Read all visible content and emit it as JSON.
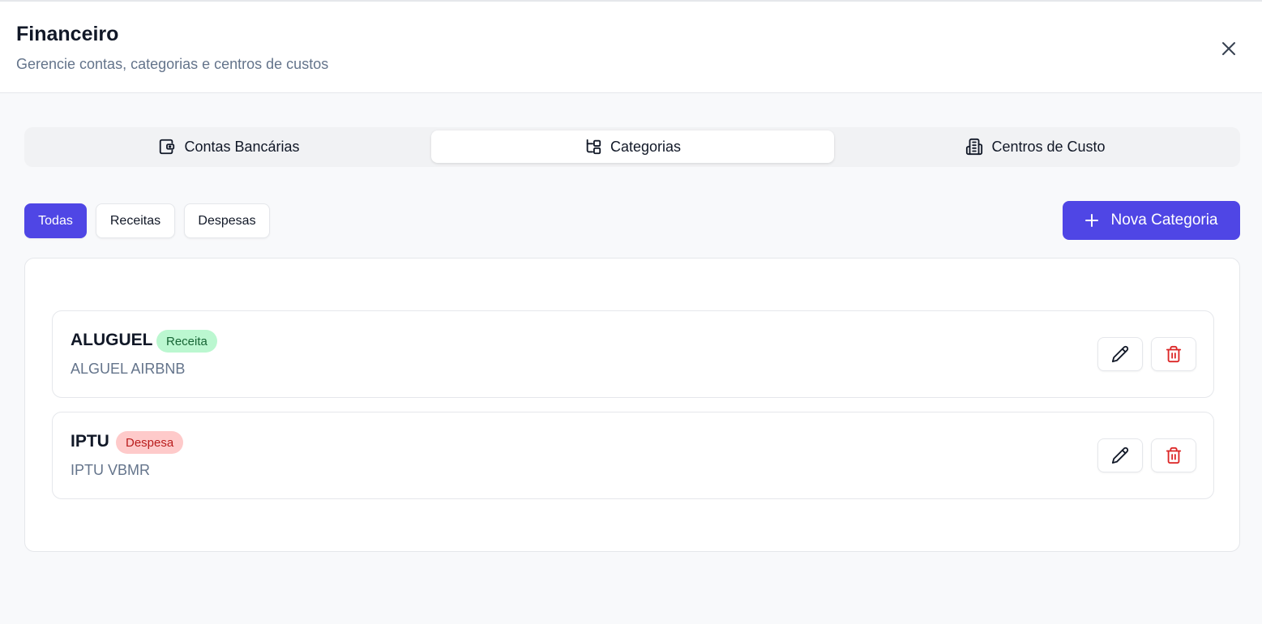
{
  "header": {
    "title": "Financeiro",
    "subtitle": "Gerencie contas, categorias e centros de custos",
    "close_icon": "close-icon"
  },
  "tabs": [
    {
      "label": "Contas Bancárias",
      "icon": "wallet-icon",
      "active": false
    },
    {
      "label": "Categorias",
      "icon": "category-tree-icon",
      "active": true
    },
    {
      "label": "Centros de Custo",
      "icon": "building-icon",
      "active": false
    }
  ],
  "filters": [
    {
      "label": "Todas",
      "active": true
    },
    {
      "label": "Receitas",
      "active": false
    },
    {
      "label": "Despesas",
      "active": false
    }
  ],
  "new_button": {
    "label": "Nova Categoria",
    "icon": "plus-icon"
  },
  "categories": [
    {
      "name": "ALUGUEL",
      "type": "Receita",
      "description": "ALGUEL AIRBNB"
    },
    {
      "name": "IPTU",
      "type": "Despesa",
      "description": "IPTU VBMR"
    }
  ],
  "colors": {
    "primary": "#4f46e5",
    "receita_bg": "#bbf7d0",
    "receita_text": "#166534",
    "despesa_bg": "#fecaca",
    "despesa_text": "#b91c1c",
    "delete_icon": "#dc2626"
  }
}
